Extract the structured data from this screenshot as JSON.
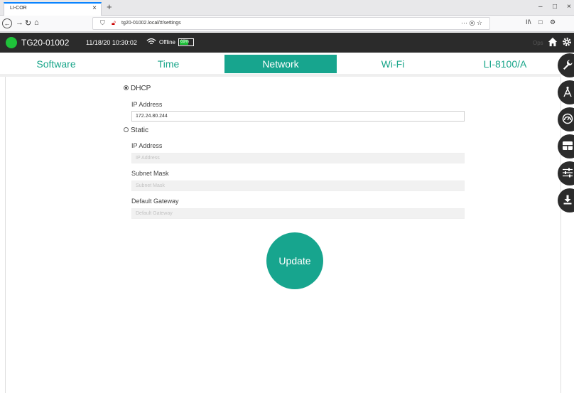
{
  "browser": {
    "tab_title": "LI-COR",
    "tab_close": "×",
    "new_tab": "+",
    "url": "tg20-01002.local/#/settings",
    "window_controls": [
      "–",
      "□",
      "×"
    ],
    "url_actions": "··· ◎ ☆",
    "toolbar_right": [
      "II\\",
      "□",
      "⚙"
    ]
  },
  "app_header": {
    "device_name": "TG20-01002",
    "datetime": "11/18/20 10:30:02",
    "connection_status": "Offline",
    "battery_label": "69%",
    "battery_level": 0.69,
    "faded_label": "Ops",
    "status_color": "#1fc23a"
  },
  "tabs": [
    {
      "label": "Software",
      "active": false
    },
    {
      "label": "Time",
      "active": false
    },
    {
      "label": "Network",
      "active": true
    },
    {
      "label": "Wi-Fi",
      "active": false
    },
    {
      "label": "LI-8100/A",
      "active": false
    }
  ],
  "side_icons": [
    "wrench-icon",
    "compass-icon",
    "gauge-icon",
    "layout-icon",
    "sliders-icon",
    "download-icon"
  ],
  "network": {
    "dhcp": {
      "label": "DHCP",
      "selected": true,
      "ip_label": "IP Address",
      "ip_value": "172.24.80.244"
    },
    "static": {
      "label": "Static",
      "selected": false,
      "ip_label": "IP Address",
      "ip_placeholder": "IP Address",
      "subnet_label": "Subnet Mask",
      "subnet_placeholder": "Subnet Mask",
      "gateway_label": "Default Gateway",
      "gateway_placeholder": "Default Gateway"
    },
    "update_label": "Update"
  },
  "colors": {
    "accent": "#17a58e",
    "header_bg": "#2b2b2b",
    "status_green": "#1fc23a"
  }
}
